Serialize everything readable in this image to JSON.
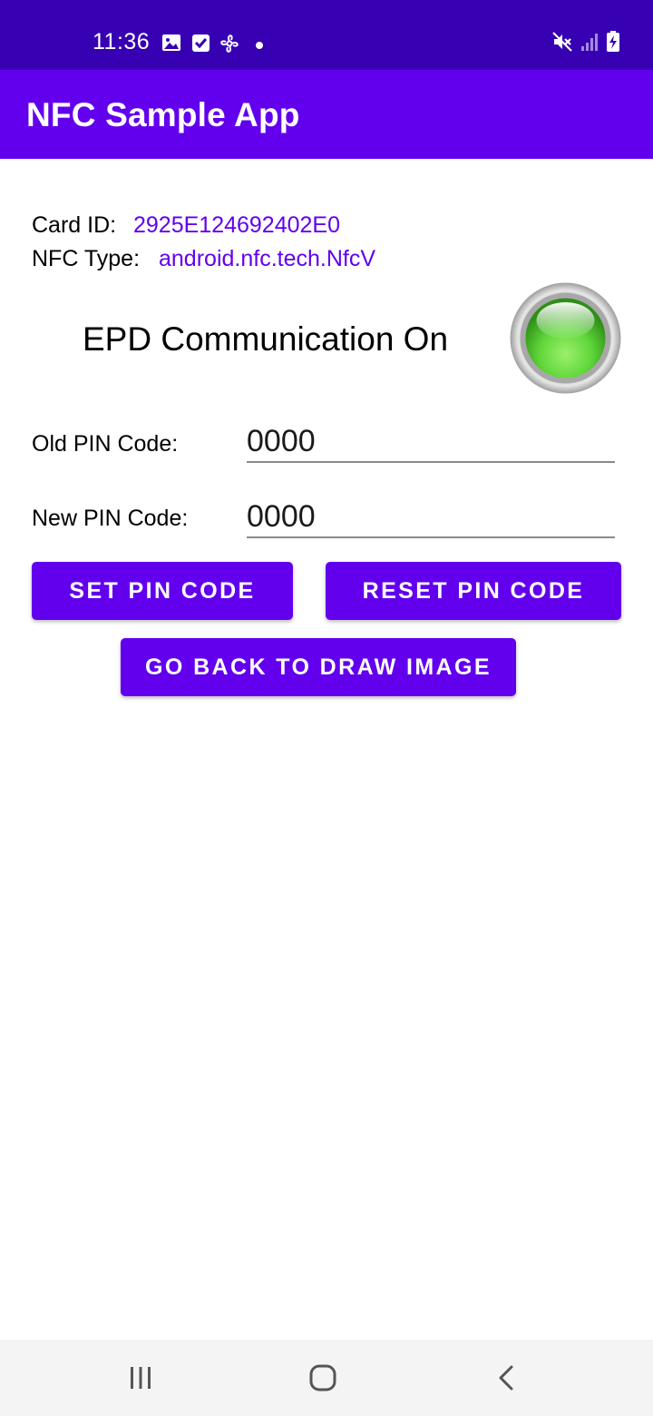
{
  "status_bar": {
    "time": "11:36",
    "bg_color": "#3700b3",
    "left_icons": [
      "image-icon",
      "checkbox-icon",
      "fan-icon",
      "dot-icon"
    ],
    "right_icons": [
      "mute-icon",
      "signal-icon",
      "battery-charging-icon"
    ]
  },
  "app_bar": {
    "title": "NFC Sample App",
    "bg_color": "#6200ee"
  },
  "card_info": {
    "card_id_label": "Card ID:",
    "card_id_value": "2925E124692402E0",
    "nfc_type_label": "NFC Type:",
    "nfc_type_value": "android.nfc.tech.NfcV",
    "value_color": "#6200ee"
  },
  "epd_status": {
    "text": "EPD Communication On",
    "indicator_icon": "green-led-icon",
    "indicator_color": "#5fd63a"
  },
  "pin_form": {
    "old_label": "Old PIN Code:",
    "old_value": "0000",
    "new_label": "New PIN Code:",
    "new_value": "0000"
  },
  "buttons": {
    "set_pin": "SET PIN CODE",
    "reset_pin": "RESET PIN CODE",
    "go_back": "GO BACK TO DRAW IMAGE",
    "bg_color": "#6200ee"
  },
  "nav_bar": {
    "icons": [
      "recent-apps-icon",
      "home-icon",
      "back-icon"
    ]
  }
}
